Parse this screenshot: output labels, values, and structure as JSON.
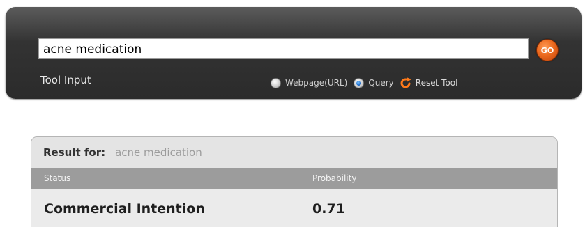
{
  "tool": {
    "query_value": "acne medication",
    "go_label": "GO",
    "input_label": "Tool Input",
    "modes": [
      {
        "label": "Webpage(URL)",
        "checked": false
      },
      {
        "label": "Query",
        "checked": true
      }
    ],
    "reset_label": "Reset Tool",
    "reset_icon": "reset-arrow-icon"
  },
  "results": {
    "for_label": "Result for:",
    "for_value": "acne medication",
    "columns": [
      "Status",
      "Probability"
    ],
    "rows": [
      {
        "status": "Commercial Intention",
        "probability": "0.71"
      }
    ]
  },
  "colors": {
    "panel_bg": "#2b2b2b",
    "go_button": "#ec6a1f",
    "radio_checked": "#1f6fd0",
    "column_header_bg": "#9c9c9c",
    "result_value_text": "#9c9c9c"
  }
}
